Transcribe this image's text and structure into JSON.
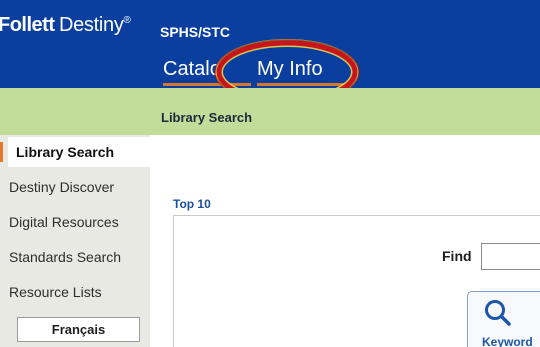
{
  "brand": {
    "name_bold": "Follett",
    "name_regular": "Destiny",
    "mark": "®"
  },
  "site": {
    "name": "SPHS/STC"
  },
  "nav": {
    "tabs": [
      {
        "label": "Catalo",
        "active": false
      },
      {
        "label": "My Info",
        "active": false
      }
    ],
    "highlight_color": "#c8141b"
  },
  "breadcrumb": {
    "current": "Library Search"
  },
  "sidebar": {
    "items": [
      {
        "label": "Library Search",
        "active": true
      },
      {
        "label": "Destiny Discover",
        "active": false
      },
      {
        "label": "Digital Resources",
        "active": false
      },
      {
        "label": "Standards Search",
        "active": false
      },
      {
        "label": "Resource Lists",
        "active": false
      }
    ],
    "language_button": "Français"
  },
  "main": {
    "top10_label": "Top 10",
    "find_label": "Find",
    "find_input_value": "",
    "keyword_button_label": "Keyword",
    "keyword_icon": "search-icon"
  },
  "colors": {
    "header": "#0a3f9f",
    "subbar": "#c2dd9a",
    "sidebar": "#e9e9e3",
    "accent_orange": "#d7772b",
    "link_blue": "#1c4e9e"
  }
}
